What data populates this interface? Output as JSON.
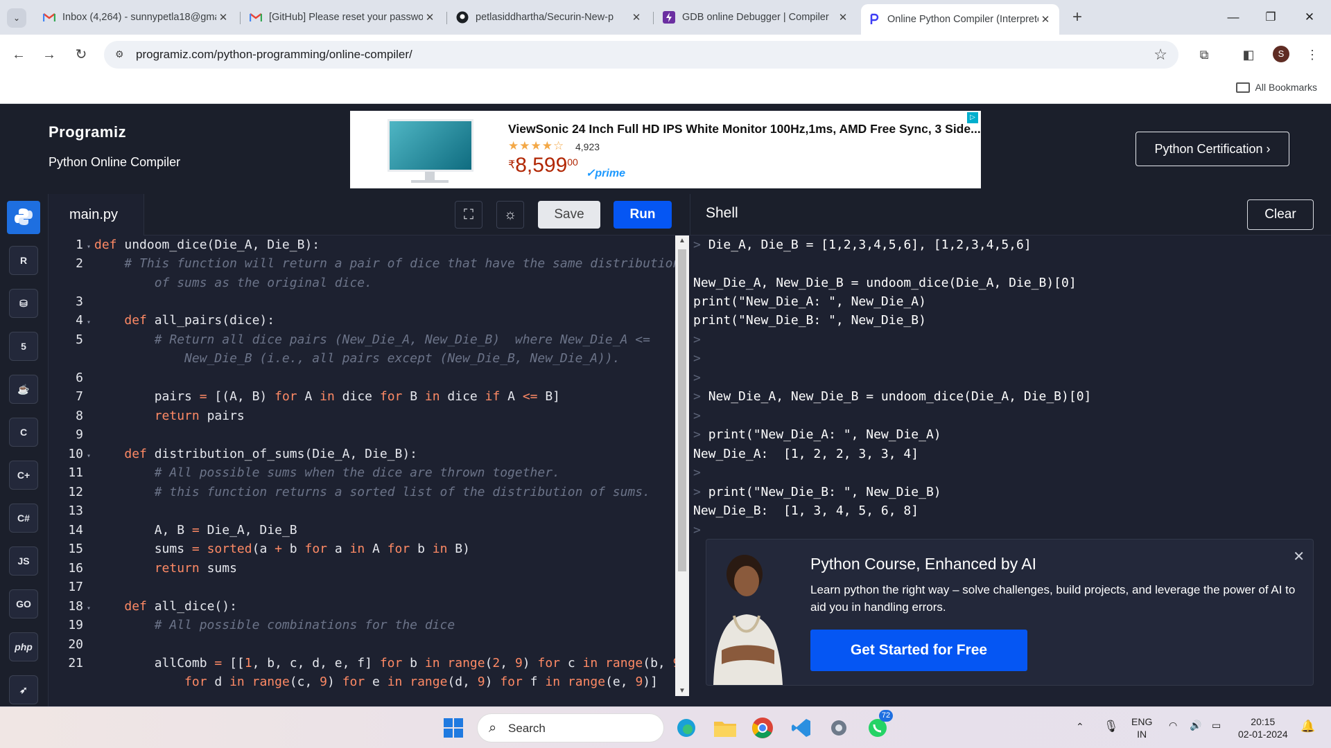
{
  "browser": {
    "tabs": [
      {
        "title": "Inbox (4,264) - sunnypetla18@gmail.com",
        "icon": "gmail-icon"
      },
      {
        "title": "[GitHub] Please reset your password",
        "icon": "gmail-icon"
      },
      {
        "title": "petlasiddhartha/Securin-New-p",
        "icon": "github-icon"
      },
      {
        "title": "GDB online Debugger | Compiler",
        "icon": "gdb-icon"
      },
      {
        "title": "Online Python Compiler (Interpreter)",
        "icon": "programiz-icon"
      }
    ],
    "url": "programiz.com/python-programming/online-compiler/",
    "profile_initial": "S",
    "bookmarks_label": "All Bookmarks"
  },
  "header": {
    "logo": "Programiz",
    "subtitle": "Python Online Compiler",
    "cert_button": "Python Certification ›"
  },
  "ad": {
    "title": "ViewSonic 24 Inch Full HD IPS White Monitor 100Hz,1ms, AMD Free Sync, 3 Side...",
    "stars": "★★★★☆",
    "reviews": "4,923",
    "price_currency": "₹",
    "price": "8,599",
    "price_paise": "00",
    "prime": "✓prime",
    "info_badge": "▷"
  },
  "sidebar": {
    "items": [
      {
        "name": "python",
        "label": "Py"
      },
      {
        "name": "r",
        "label": "R"
      },
      {
        "name": "sql",
        "label": "DB"
      },
      {
        "name": "html",
        "label": "5"
      },
      {
        "name": "java",
        "label": "☕"
      },
      {
        "name": "c",
        "label": "C"
      },
      {
        "name": "cpp",
        "label": "C+"
      },
      {
        "name": "csharp",
        "label": "C#"
      },
      {
        "name": "javascript",
        "label": "JS"
      },
      {
        "name": "go",
        "label": "GO"
      },
      {
        "name": "php",
        "label": "php"
      },
      {
        "name": "swift",
        "label": "➶"
      }
    ]
  },
  "editor": {
    "filename": "main.py",
    "save_label": "Save",
    "run_label": "Run",
    "line_numbers": [
      "1",
      "2",
      "",
      "3",
      "4",
      "5",
      "",
      "6",
      "7",
      "8",
      "9",
      "10",
      "11",
      "12",
      "13",
      "14",
      "15",
      "16",
      "17",
      "18",
      "19",
      "20",
      "21",
      ""
    ],
    "fold_lines": [
      "1",
      "4",
      "10",
      "18"
    ]
  },
  "shell": {
    "title": "Shell",
    "clear_label": "Clear",
    "lines": [
      {
        "prompt": "> ",
        "text": "Die_A, Die_B = [1,2,3,4,5,6], [1,2,3,4,5,6]"
      },
      {
        "prompt": "",
        "text": ""
      },
      {
        "prompt": "",
        "text": "New_Die_A, New_Die_B = undoom_dice(Die_A, Die_B)[0]"
      },
      {
        "prompt": "",
        "text": "print(\"New_Die_A: \", New_Die_A)"
      },
      {
        "prompt": "",
        "text": "print(\"New_Die_B: \", New_Die_B)"
      },
      {
        "prompt": ">",
        "text": ""
      },
      {
        "prompt": ">",
        "text": ""
      },
      {
        "prompt": ">",
        "text": ""
      },
      {
        "prompt": "> ",
        "text": "New_Die_A, New_Die_B = undoom_dice(Die_A, Die_B)[0]"
      },
      {
        "prompt": ">",
        "text": ""
      },
      {
        "prompt": "> ",
        "text": "print(\"New_Die_A: \", New_Die_A)"
      },
      {
        "prompt": "",
        "text": "New_Die_A:  [1, 2, 2, 3, 3, 4]"
      },
      {
        "prompt": ">",
        "text": ""
      },
      {
        "prompt": "> ",
        "text": "print(\"New_Die_B: \", New_Die_B)"
      },
      {
        "prompt": "",
        "text": "New_Die_B:  [1, 3, 4, 5, 6, 8]"
      },
      {
        "prompt": ">",
        "text": ""
      }
    ]
  },
  "promo": {
    "title": "Python Course, Enhanced by AI",
    "text": "Learn python the right way – solve challenges, build projects, and leverage the power of AI to aid you in handling errors.",
    "cta": "Get Started for Free",
    "close": "✕"
  },
  "taskbar": {
    "search_placeholder": "Search",
    "whatsapp_badge": "72",
    "language": "ENG",
    "region": "IN",
    "time": "20:15",
    "date": "02-01-2024"
  }
}
